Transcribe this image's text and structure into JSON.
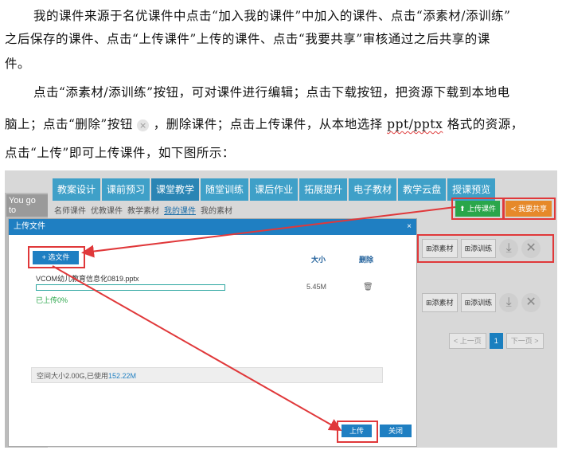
{
  "paragraphs": {
    "p1_l1": "我的课件来源于名优课件中点击“加入我的课件”中加入的课件、点击“添素材/添训练”",
    "p1_l2": "之后保存的课件、点击“上传课件”上传的课件、点击“我要共享”审核通过之后共享的课",
    "p1_l3": "件。",
    "p2_l1": "点击“添素材/添训练”按钮，可对课件进行编辑；点击下载按钮，把资源下载到本地电",
    "p2_l2a": "脑上；点击“删除”按钮",
    "p2_l2b": "，删除课件；点击上传课件，从本地选择 ",
    "p2_l2c": "ppt/pptx",
    "p2_l2d": " 格式的资源，",
    "p2_l3": "点击“上传”即可上传课件，如下图所示："
  },
  "screenshot": {
    "left_text": "You go to",
    "nav_tabs": [
      "教案设计",
      "课前预习",
      "课堂教学",
      "随堂训练",
      "课后作业",
      "拓展提升",
      "电子教材",
      "教学云盘",
      "授课预览"
    ],
    "sub_nav": [
      "名师课件",
      "优教课件",
      "教学素材",
      "我的课件",
      "我的素材"
    ],
    "upload_course_btn": "上传课件",
    "share_btn": "我要共享",
    "add_material_btn": "添素材",
    "add_training_btn": "添训练",
    "pager": {
      "prev": "< 上一页",
      "page": "1",
      "next": "下一页 >"
    },
    "dialog": {
      "title": "上传文件",
      "close": "×",
      "pick_file_btn": "选文件",
      "col_size": "大小",
      "col_delete": "删除",
      "file_name": "VCOM幼儿教育信息化0819.pptx",
      "progress_text": "已上传0%",
      "progress": 0,
      "file_size": "5.45M",
      "space_label": "空间大小2.00G,已使用",
      "space_used": "152.22M",
      "upload_btn": "上传",
      "close_btn": "关闭"
    }
  },
  "colors": {
    "accent": "#1f7fc2",
    "red": "#e0383a",
    "green": "#2aa64a",
    "orange": "#e6892a"
  }
}
